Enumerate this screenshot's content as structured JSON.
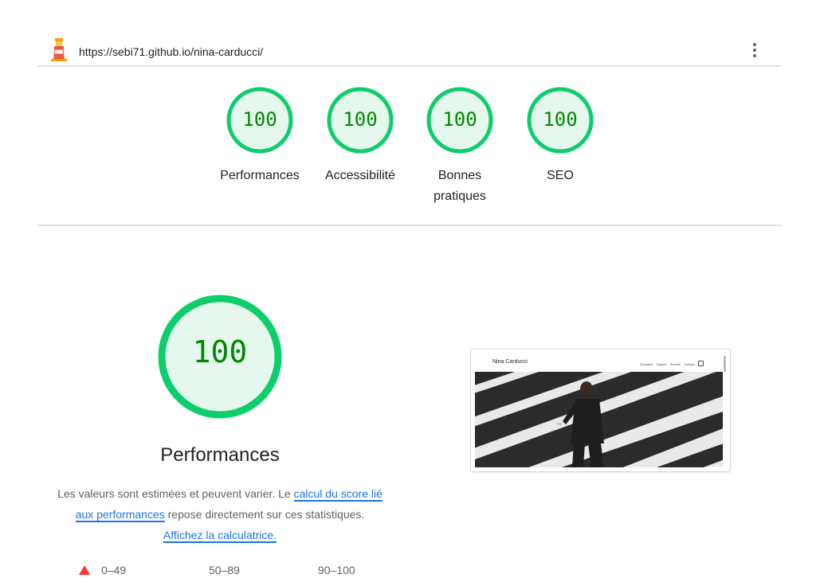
{
  "header": {
    "url": "https://sebi71.github.io/nina-carducci/",
    "logo_icon": "lighthouse-icon",
    "menu_icon": "vertical-dots-icon"
  },
  "categories": [
    {
      "score": "100",
      "label": "Performances",
      "value": 1.0
    },
    {
      "score": "100",
      "label": "Accessibilité",
      "value": 1.0
    },
    {
      "score": "100",
      "label": "Bonnes pratiques",
      "value": 1.0
    },
    {
      "score": "100",
      "label": "SEO",
      "value": 1.0
    }
  ],
  "performance": {
    "score": "100",
    "title": "Performances",
    "desc_part1": "Les valeurs sont estimées et peuvent varier. Le ",
    "link_calc": "calcul du score lié aux performances",
    "desc_part2": " repose directement sur ces statistiques. ",
    "link_calculator": "Affichez la calculatrice.",
    "legend": [
      "0–49",
      "50–89",
      "90–100"
    ]
  },
  "screenshot": {
    "brand": "Nina Carducci",
    "nav": [
      "À propos",
      "Galerie",
      "Service",
      "Contact"
    ]
  },
  "colors": {
    "pass": "#0cce6b",
    "pass_bg": "#e6f8ee",
    "pass_text": "#008800",
    "fail": "#ff3333",
    "link": "#1a73e8"
  }
}
